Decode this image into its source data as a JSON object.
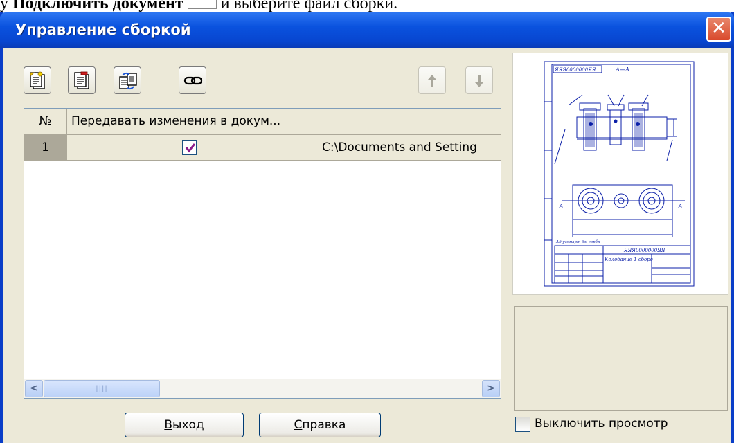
{
  "document_text": {
    "prefix": "у ",
    "bold": "Подключить документ",
    "suffix": "и выберите файл сборки."
  },
  "window": {
    "title": "Управление сборкой",
    "close_label": "✕"
  },
  "toolbar": {
    "buttons": [
      {
        "icon": "add-document-icon",
        "enabled": true
      },
      {
        "icon": "remove-document-icon",
        "enabled": true
      },
      {
        "icon": "replace-document-icon",
        "enabled": true
      },
      {
        "icon": "link-icon",
        "enabled": true
      },
      {
        "icon": "arrow-up-icon",
        "enabled": false
      },
      {
        "icon": "arrow-down-icon",
        "enabled": false
      }
    ]
  },
  "table": {
    "headers": [
      "№",
      "Передавать изменения в докум...",
      ""
    ],
    "rows": [
      {
        "num": "1",
        "transfer_changes": true,
        "path": "C:\\Documents and Setting"
      }
    ]
  },
  "scrollbar": {
    "left_arrow": "<",
    "right_arrow": ">",
    "thumb_grip": "||||"
  },
  "preview": {
    "drawing_text": {
      "designation_top": "ЯЯЯ0000000ЯЯ",
      "section_label": "А—А",
      "view_label_left": "А",
      "view_label_right": "А",
      "note": "Ад угемарт 6м сорбя",
      "stamp_designation": "ЯЯЯ0000000ЯЯ",
      "stamp_title": "Колебание 1 сборе"
    }
  },
  "buttons": {
    "exit": {
      "mnemonic": "В",
      "rest": "ыход"
    },
    "help": {
      "mnemonic": "С",
      "rest": "правка"
    }
  },
  "disable_preview": {
    "label": "Выключить просмотр",
    "checked": false
  },
  "colors": {
    "titlebar": "#0a52de",
    "dialog_bg": "#ece9d8",
    "check_mark": "#8b1a89",
    "close_button": "#d9492c"
  }
}
